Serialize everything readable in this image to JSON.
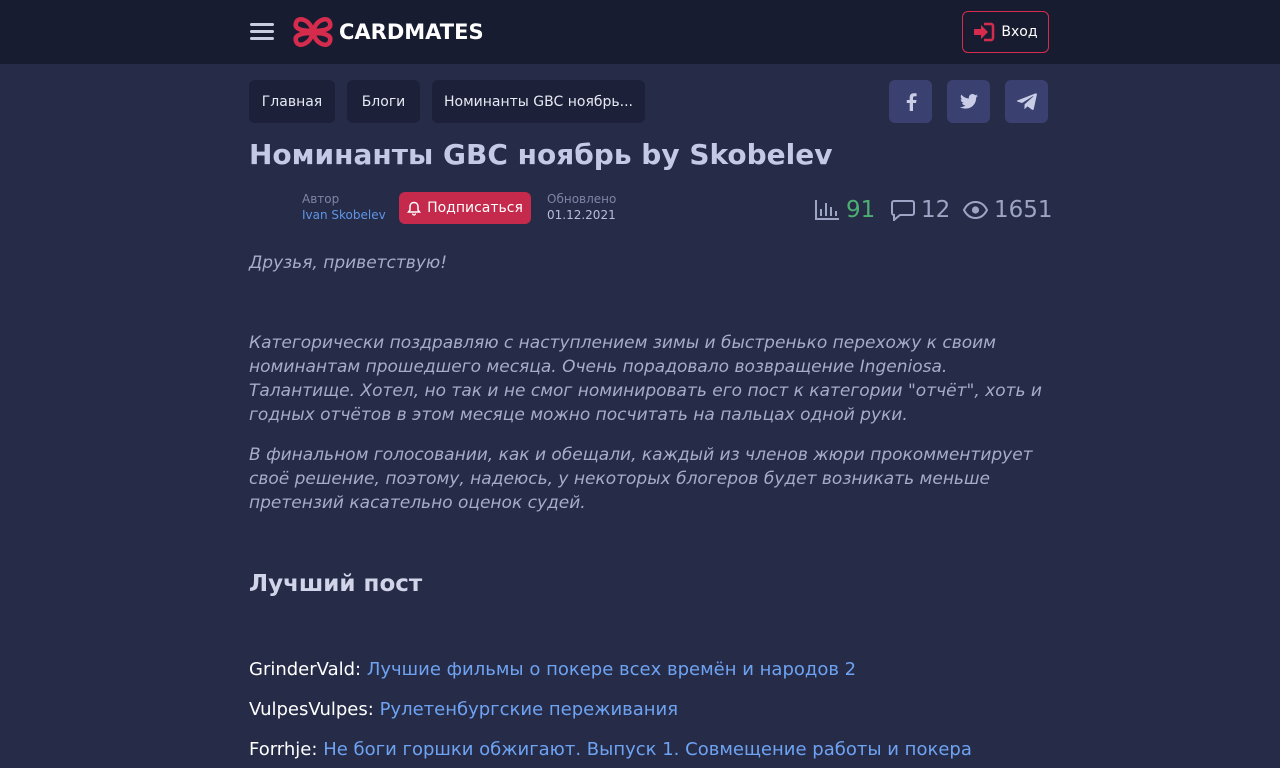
{
  "header": {
    "logo_text": "CARDMATES",
    "login_label": "Вход",
    "brand_color": "#d52c4e"
  },
  "breadcrumbs": [
    "Главная",
    "Блоги",
    "Номинанты GBC ноябрь..."
  ],
  "share": [
    "facebook-icon",
    "twitter-icon",
    "telegram-icon"
  ],
  "article": {
    "title": "Номинанты GBC ноябрь by Skobelev",
    "author_label": "Автор",
    "author_name": "Ivan Skobelev",
    "subscribe_label": "Подписаться",
    "updated_label": "Обновлено",
    "updated_date": "01.12.2021",
    "rating": "91",
    "comments": "12",
    "views": "1651",
    "greeting": "Друзья, приветствую!",
    "para1": "Категорически поздравляю с наступлением зимы и быстренько перехожу к своим номинантам прошедшего месяца. Очень порадовало возвращение Ingeniosa. Талантище. Хотел, но так и не смог номинировать его пост к категории \"отчёт\", хоть и годных отчётов в этом месяце можно посчитать на пальцах одной руки.",
    "para2": "В финальном голосовании, как и обещали, каждый из членов жюри прокомментирует своё решение, поэтому, надеюсь, у некоторых блогеров будет возникать меньше претензий касательно оценок судей.",
    "section_title": "Лучший пост",
    "nominees": [
      {
        "author": "GrinderVald:",
        "post": "Лучшие фильмы о покере всех времён и народов 2"
      },
      {
        "author": "VulpesVulpes",
        "post": "Рулетенбургские переживания"
      },
      {
        "author": "Forrhje:",
        "post": "Не боги горшки обжигают. Выпуск 1. Совмещение работы и покера"
      }
    ]
  }
}
